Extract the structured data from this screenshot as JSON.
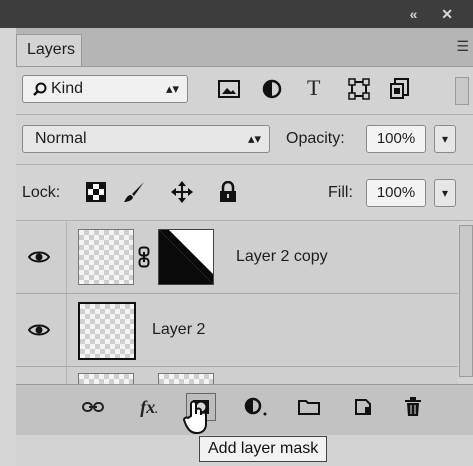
{
  "window": {
    "controls": "« ✕"
  },
  "panel": {
    "tab_label": "Layers",
    "menu_icon": "panel-menu-icon",
    "filter": {
      "kind_label": "Kind",
      "icons": [
        "image-filter-icon",
        "adjustment-filter-icon",
        "type-filter-icon",
        "shape-filter-icon",
        "smart-object-filter-icon"
      ]
    },
    "blend": {
      "mode": "Normal",
      "opacity_label": "Opacity:",
      "opacity_value": "100%"
    },
    "lock": {
      "label": "Lock:",
      "fill_label": "Fill:",
      "fill_value": "100%"
    },
    "layers": [
      {
        "name": "Layer 2 copy",
        "visible": true,
        "has_mask": true
      },
      {
        "name": "Layer 2",
        "visible": true,
        "has_mask": false
      }
    ],
    "bottom_buttons": [
      "link-layers-icon",
      "layer-style-fx-icon",
      "add-layer-mask-icon",
      "new-adjustment-layer-icon",
      "new-group-folder-icon",
      "new-layer-icon",
      "delete-layer-trash-icon"
    ],
    "fx_label": "fx"
  },
  "tooltip": {
    "text": "Add layer mask"
  }
}
